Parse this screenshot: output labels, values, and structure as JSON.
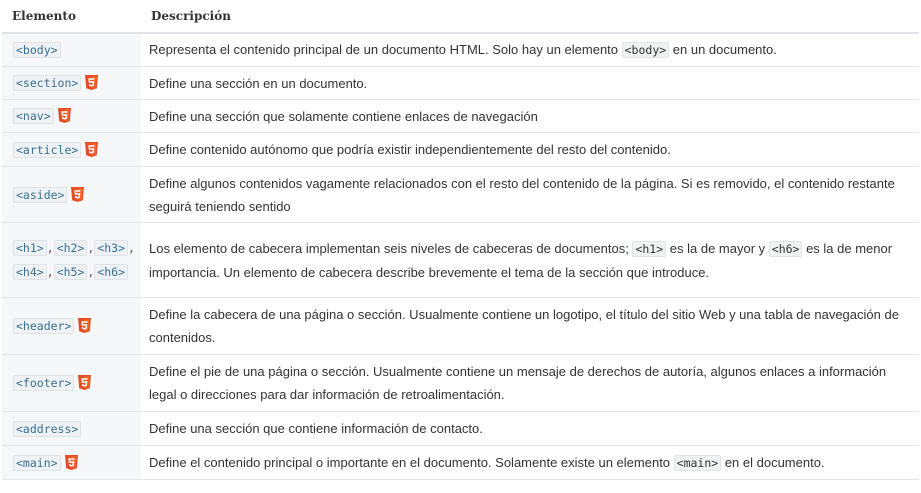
{
  "table": {
    "headers": {
      "element": "Elemento",
      "description": "Descripción"
    },
    "rows": [
      {
        "tags": [
          "<body>"
        ],
        "html5": false,
        "desc": [
          {
            "t": "Representa el contenido principal de un documento HTML. Solo hay un elemento "
          },
          {
            "c": "<body>"
          },
          {
            "t": " en un documento."
          }
        ]
      },
      {
        "tags": [
          "<section>"
        ],
        "html5": true,
        "desc": [
          {
            "t": "Define una sección en un documento."
          }
        ]
      },
      {
        "tags": [
          "<nav>"
        ],
        "html5": true,
        "desc": [
          {
            "t": "Define una sección que solamente contiene enlaces de navegación"
          }
        ]
      },
      {
        "tags": [
          "<article>"
        ],
        "html5": true,
        "desc": [
          {
            "t": "Define contenido autónomo que podría existir independientemente del resto del contenido."
          }
        ]
      },
      {
        "tags": [
          "<aside>"
        ],
        "html5": true,
        "desc": [
          {
            "t": "Define algunos contenidos vagamente relacionados con el resto del contenido de la página. Si es removido, el contenido restante seguirá teniendo sentido"
          }
        ]
      },
      {
        "tags": [
          "<h1>",
          "<h2>",
          "<h3>",
          "<h4>",
          "<h5>",
          "<h6>"
        ],
        "html5": false,
        "desc": [
          {
            "t": "Los elemento de cabecera  implementan seis niveles de cabeceras de documentos; "
          },
          {
            "c": "<h1>"
          },
          {
            "t": " es la de mayor y "
          },
          {
            "c": "<h6>"
          },
          {
            "t": " es la de menor importancia. Un elemento de cabecera describe brevemente el tema de la sección que introduce."
          }
        ]
      },
      {
        "tags": [
          "<header>"
        ],
        "html5": true,
        "desc": [
          {
            "t": "Define la cabecera de una página o sección. Usualmente contiene un logotipo, el título del sitio Web y una tabla de navegación de contenidos."
          }
        ]
      },
      {
        "tags": [
          "<footer>"
        ],
        "html5": true,
        "desc": [
          {
            "t": "Define el pie de una página o sección. Usualmente contiene un mensaje de derechos de autoría, algunos enlaces a información legal o direcciones para dar información de retroalimentación."
          }
        ]
      },
      {
        "tags": [
          "<address>"
        ],
        "html5": false,
        "desc": [
          {
            "t": "Define una sección que contiene información de contacto."
          }
        ]
      },
      {
        "tags": [
          "<main>"
        ],
        "html5": true,
        "desc": [
          {
            "t": "Define el contenido principal o importante en el documento. Solamente existe un elemento "
          },
          {
            "c": "<main>"
          },
          {
            "t": " en el documento."
          }
        ]
      }
    ],
    "html5_badge_icon": "html5-shield-icon",
    "colors": {
      "badge": "#e44d26",
      "badge_light": "#f16529",
      "code_text": "#3a6e90",
      "element_column_bg": "#f5f7f8",
      "row_border": "#e4e7e9"
    }
  }
}
